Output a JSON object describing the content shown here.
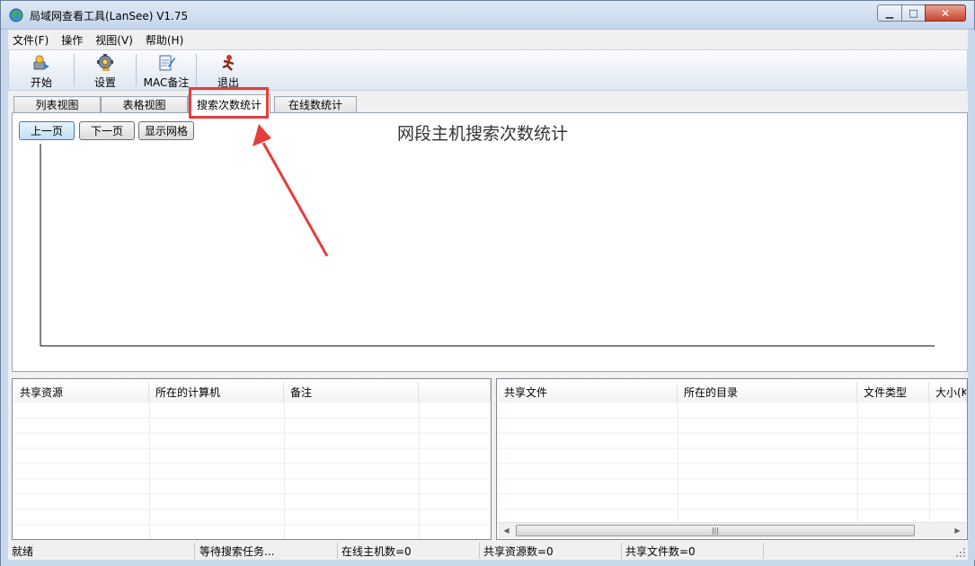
{
  "window": {
    "title": "局域网查看工具(LanSee) V1.75",
    "min_glyph": "▁",
    "max_glyph": "□",
    "close_glyph": "✕"
  },
  "menu": [
    {
      "label": "文件(F)"
    },
    {
      "label": "操作"
    },
    {
      "label": "视图(V)"
    },
    {
      "label": "帮助(H)"
    }
  ],
  "toolbar": {
    "start": {
      "label": "开始",
      "icon": "start-icon"
    },
    "settings": {
      "label": "设置",
      "icon": "gear-icon"
    },
    "mac_note": {
      "label": "MAC备注",
      "icon": "notepad-icon"
    },
    "exit": {
      "label": "退出",
      "icon": "exit-icon"
    }
  },
  "tabs": [
    {
      "label": "列表视图",
      "active": false
    },
    {
      "label": "表格视图",
      "active": false
    },
    {
      "label": "搜索次数统计",
      "active": true
    },
    {
      "label": "在线数统计",
      "active": false
    }
  ],
  "chart_panel": {
    "prev_label": "上一页",
    "next_label": "下一页",
    "grid_label": "显示网格",
    "title": "网段主机搜索次数统计"
  },
  "annotation": {
    "color": "#e53d3d"
  },
  "left_list": {
    "columns": [
      "共享资源",
      "所在的计算机",
      "备注",
      ""
    ],
    "rows": []
  },
  "right_list": {
    "columns": [
      "共享文件",
      "所在的目录",
      "文件类型",
      "大小(K"
    ],
    "rows": [],
    "scroll_left": "◀",
    "scroll_right": "▶",
    "scroll_thumb_grip": "|||"
  },
  "status": {
    "ready": "就绪",
    "task": "等待搜索任务...",
    "online_hosts": "在线主机数=0",
    "shared_resources": "共享资源数=0",
    "shared_files": "共享文件数=0"
  }
}
